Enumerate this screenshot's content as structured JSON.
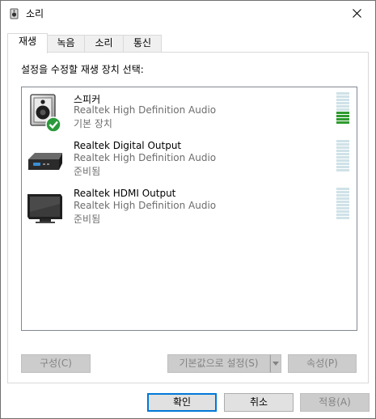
{
  "window": {
    "title": "소리",
    "close_glyph": "✕",
    "icon": "speaker-icon"
  },
  "tabs": [
    {
      "label": "재생",
      "active": true
    },
    {
      "label": "녹음",
      "active": false
    },
    {
      "label": "소리",
      "active": false
    },
    {
      "label": "통신",
      "active": false
    }
  ],
  "panel": {
    "instruction": "설정을 수정할 재생 장치 선택:"
  },
  "devices": [
    {
      "name": "스피커",
      "description": "Realtek High Definition Audio",
      "status": "기본 장치",
      "icon": "speaker-icon",
      "default": true,
      "level": 0.4
    },
    {
      "name": "Realtek Digital Output",
      "description": "Realtek High Definition Audio",
      "status": "준비됨",
      "icon": "digital-output-icon",
      "default": false,
      "level": 0
    },
    {
      "name": "Realtek HDMI Output",
      "description": "Realtek High Definition Audio",
      "status": "준비됨",
      "icon": "monitor-icon",
      "default": false,
      "level": 0
    }
  ],
  "panel_buttons": {
    "configure": "구성(C)",
    "set_default": "기본값으로 설정(S)",
    "properties": "속성(P)"
  },
  "dialog_buttons": {
    "ok": "확인",
    "cancel": "취소",
    "apply": "적용(A)"
  },
  "colors": {
    "accent": "#0078d7",
    "meter_active": "#2e9b2e",
    "meter_inactive": "#cfe2e8",
    "check_green": "#2a9a3a"
  }
}
